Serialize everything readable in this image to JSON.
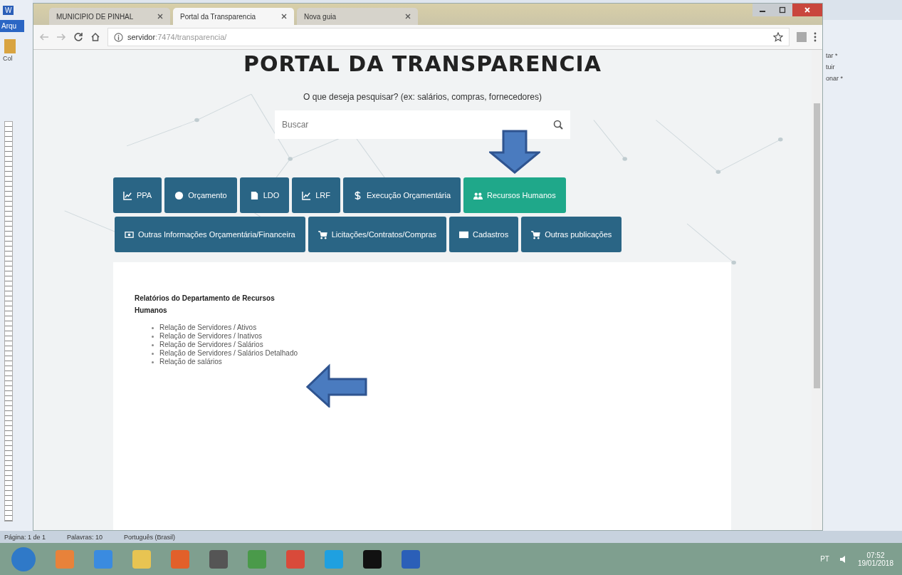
{
  "word_ribbon": {
    "logo": "W",
    "left_texts": [
      "Arqu",
      "Col"
    ],
    "right_texts": [
      "tar *",
      "tuir",
      "onar *"
    ]
  },
  "browser": {
    "tabs": [
      {
        "label": "MUNICIPIO DE PINHAL",
        "selected": false
      },
      {
        "label": "Portal da Transparencia",
        "selected": true
      },
      {
        "label": "Nova guia",
        "selected": false
      }
    ],
    "address": {
      "host": "servidor",
      "path": ":7474/transparencia/"
    }
  },
  "page": {
    "heading": "PORTAL DA TRANSPARENCIA",
    "prompt": "O que deseja pesquisar? (ex: salários, compras, fornecedores)",
    "search": {
      "placeholder": "Buscar"
    },
    "button_rows": [
      [
        {
          "label": "PPA",
          "kind": "chart",
          "selected": false
        },
        {
          "label": "Orçamento",
          "kind": "pie",
          "selected": false
        },
        {
          "label": "LDO",
          "kind": "file",
          "selected": false
        },
        {
          "label": "LRF",
          "kind": "chart",
          "selected": false
        },
        {
          "label": "Execução Orçamentária",
          "kind": "dollar",
          "selected": false
        },
        {
          "label": "Recursos Humanos",
          "kind": "users",
          "selected": true
        }
      ],
      [
        {
          "label": "Outras Informações Orçamentária/Financeira",
          "kind": "money",
          "selected": false
        },
        {
          "label": "Licitações/Contratos/Compras",
          "kind": "cart",
          "selected": false
        },
        {
          "label": "Cadastros",
          "kind": "card",
          "selected": false
        },
        {
          "label": "Outras publicações",
          "kind": "cart",
          "selected": false
        }
      ]
    ],
    "panel": {
      "title": "Relatórios do Departamento de Recursos Humanos",
      "links": [
        "Relação de Servidores / Ativos",
        "Relação de Servidores / Inativos",
        "Relação de Servidores / Salários",
        "Relação de Servidores / Salários Detalhado",
        "Relação de salários"
      ]
    }
  },
  "word_status": [
    "Página: 1 de 1",
    "Palavras: 10",
    "Português (Brasil)"
  ],
  "taskbar": {
    "language": "PT",
    "time": "07:52",
    "date": "19/01/2018"
  }
}
